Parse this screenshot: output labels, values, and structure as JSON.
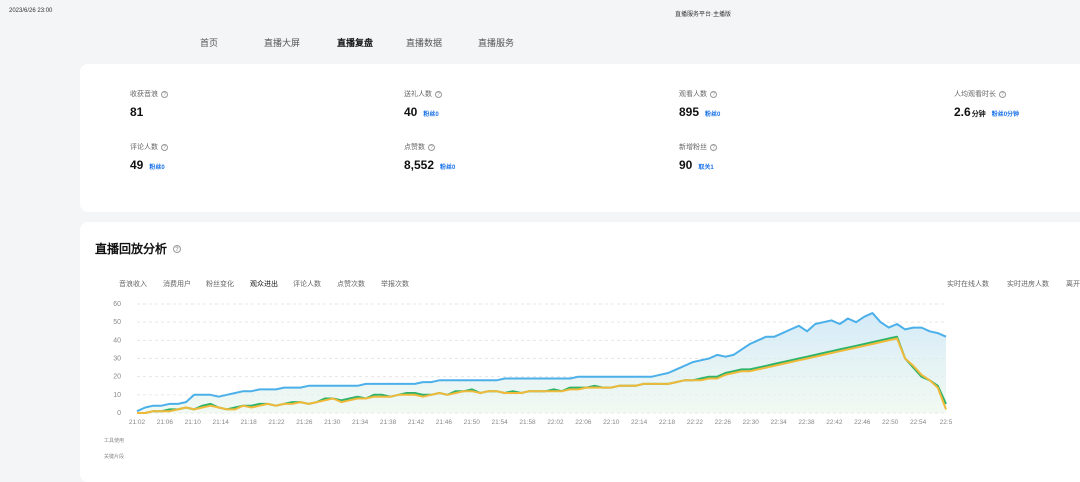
{
  "header": {
    "timestamp": "2023/6/26 23:00",
    "app_title": "直播服务平台·主播版"
  },
  "nav": {
    "tabs": [
      "首页",
      "直播大屏",
      "直播复盘",
      "直播数据",
      "直播服务"
    ],
    "active": "直播复盘"
  },
  "metrics": [
    {
      "label": "收获音浪",
      "value": "81",
      "unit": "",
      "sub": ""
    },
    {
      "label": "送礼人数",
      "value": "40",
      "unit": "",
      "sub": "粉丝0"
    },
    {
      "label": "观看人数",
      "value": "895",
      "unit": "",
      "sub": "粉丝0"
    },
    {
      "label": "人均观看时长",
      "value": "2.6",
      "unit": "分钟",
      "sub": "粉丝0分钟"
    },
    {
      "label": "评论人数",
      "value": "49",
      "unit": "",
      "sub": "粉丝0"
    },
    {
      "label": "点赞数",
      "value": "8,552",
      "unit": "",
      "sub": "粉丝0"
    },
    {
      "label": "新增粉丝",
      "value": "90",
      "unit": "",
      "sub": "取关1"
    }
  ],
  "analysis": {
    "title": "直播回放分析",
    "left_tabs": [
      "音浪收入",
      "消费用户",
      "粉丝变化",
      "观众进出",
      "评论人数",
      "点赞次数",
      "举报次数"
    ],
    "active_tab": "观众进出",
    "right_tabs": [
      "实时在线人数",
      "实时进房人数",
      "离开"
    ],
    "row_labels": [
      "工具使用",
      "关键片段"
    ]
  },
  "chart_data": {
    "type": "line",
    "ylim": [
      0,
      60
    ],
    "yticks": [
      0,
      10,
      20,
      30,
      40,
      50,
      60
    ],
    "x_labels": [
      "21:02",
      "21:06",
      "21:10",
      "21:14",
      "21:18",
      "21:22",
      "21:26",
      "21:30",
      "21:34",
      "21:38",
      "21:42",
      "21:46",
      "21:50",
      "21:54",
      "21:58",
      "22:02",
      "22:06",
      "22:10",
      "22:14",
      "22:18",
      "22:22",
      "22:26",
      "22:30",
      "22:34",
      "22:38",
      "22:42",
      "22:46",
      "22:50",
      "22:54",
      "22:5"
    ],
    "series": [
      {
        "color": "#4bb0ea",
        "values": [
          1,
          3,
          4,
          4,
          5,
          5,
          6,
          10,
          10,
          10,
          9,
          10,
          11,
          12,
          12,
          13,
          13,
          13,
          14,
          14,
          14,
          15,
          15,
          15,
          15,
          15,
          15,
          15,
          16,
          16,
          16,
          16,
          16,
          16,
          16,
          17,
          17,
          18,
          18,
          18,
          18,
          18,
          18,
          18,
          18,
          19,
          19,
          19,
          19,
          19,
          19,
          19,
          19,
          19,
          20,
          20,
          20,
          20,
          20,
          20,
          20,
          20,
          20,
          20,
          21,
          22,
          24,
          26,
          28,
          29,
          30,
          32,
          31,
          32,
          35,
          38,
          40,
          42,
          42,
          44,
          46,
          48,
          45,
          49,
          50,
          51,
          49,
          52,
          50,
          53,
          55,
          50,
          47,
          49,
          46,
          47,
          47,
          45,
          44,
          42
        ]
      },
      {
        "color": "#2db36a",
        "values": [
          0,
          0,
          1,
          1,
          2,
          2,
          3,
          2,
          4,
          5,
          3,
          2,
          3,
          4,
          4,
          5,
          5,
          4,
          5,
          6,
          6,
          5,
          6,
          8,
          8,
          7,
          8,
          9,
          8,
          10,
          10,
          9,
          10,
          11,
          11,
          10,
          10,
          11,
          10,
          12,
          12,
          13,
          11,
          12,
          12,
          11,
          12,
          11,
          12,
          12,
          12,
          13,
          12,
          14,
          14,
          14,
          15,
          14,
          14,
          15,
          15,
          15,
          16,
          16,
          16,
          16,
          17,
          18,
          18,
          19,
          20,
          20,
          22,
          23,
          24,
          24,
          25,
          26,
          27,
          28,
          29,
          30,
          31,
          32,
          33,
          34,
          35,
          36,
          37,
          38,
          39,
          40,
          41,
          42,
          30,
          25,
          20,
          18,
          15,
          5
        ]
      },
      {
        "color": "#f0b93a",
        "values": [
          0,
          0,
          1,
          1,
          1,
          2,
          3,
          2,
          3,
          4,
          3,
          2,
          2,
          4,
          3,
          4,
          5,
          4,
          5,
          5,
          6,
          5,
          6,
          7,
          8,
          6,
          7,
          8,
          8,
          9,
          9,
          9,
          10,
          10,
          10,
          9,
          10,
          11,
          10,
          11,
          12,
          12,
          11,
          12,
          12,
          11,
          11,
          11,
          12,
          12,
          12,
          12,
          12,
          13,
          13,
          14,
          14,
          14,
          14,
          15,
          15,
          15,
          16,
          16,
          16,
          16,
          17,
          18,
          18,
          18,
          19,
          19,
          21,
          22,
          23,
          23,
          24,
          25,
          26,
          27,
          28,
          29,
          30,
          31,
          32,
          33,
          34,
          35,
          36,
          37,
          38,
          39,
          40,
          41,
          30,
          26,
          21,
          18,
          14,
          2
        ]
      }
    ]
  }
}
